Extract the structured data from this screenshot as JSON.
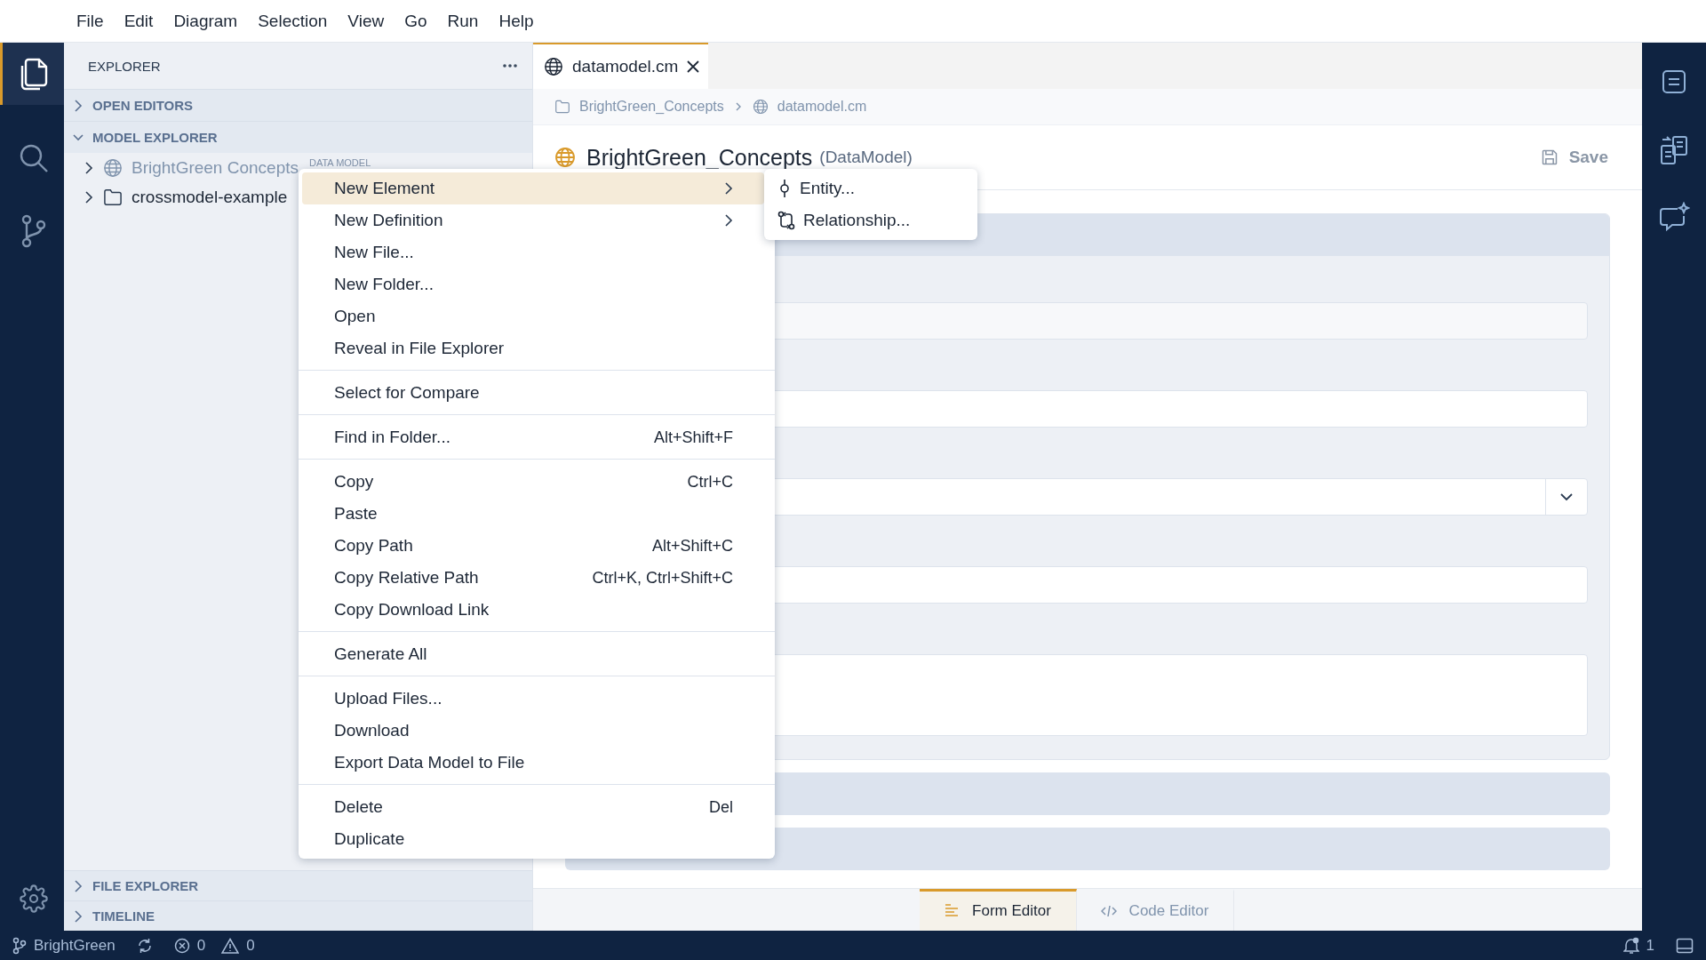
{
  "menubar": [
    "File",
    "Edit",
    "Diagram",
    "Selection",
    "View",
    "Go",
    "Run",
    "Help"
  ],
  "activity_bar": {
    "items": [
      {
        "kind": "files",
        "selected": true
      },
      {
        "kind": "search",
        "selected": false
      },
      {
        "kind": "source-control",
        "selected": false
      }
    ],
    "bottom": [
      {
        "kind": "settings"
      }
    ]
  },
  "sidebar": {
    "title": "EXPLORER",
    "sections": [
      {
        "label": "OPEN EDITORS",
        "expanded": false
      },
      {
        "label": "MODEL EXPLORER",
        "expanded": true,
        "items": [
          {
            "label": "BrightGreen Concepts",
            "badge": "DATA MODEL",
            "kind": "model",
            "expanded": false
          },
          {
            "label": "crossmodel-example",
            "kind": "folder",
            "expanded": false
          }
        ]
      }
    ],
    "bottom_sections": [
      {
        "label": "FILE EXPLORER",
        "expanded": false
      },
      {
        "label": "TIMELINE",
        "expanded": false
      }
    ]
  },
  "editor": {
    "tabs": [
      {
        "label": "datamodel.cm",
        "selected": true
      }
    ],
    "breadcrumb": [
      {
        "label": "BrightGreen_Concepts",
        "kind": "folder"
      },
      {
        "label": "datamodel.cm",
        "kind": "model"
      }
    ],
    "title": "BrightGreen_Concepts",
    "type": "(DataModel)",
    "save": {
      "label": "Save",
      "disabled": true
    },
    "form": {
      "fields": [
        {
          "kind": "input"
        },
        {
          "kind": "input"
        },
        {
          "kind": "select"
        },
        {
          "kind": "input"
        },
        {
          "kind": "textarea"
        }
      ]
    },
    "view_tabs": [
      {
        "label": "Form Editor",
        "kind": "form",
        "selected": true
      },
      {
        "label": "Code Editor",
        "kind": "code",
        "selected": false
      }
    ]
  },
  "right_bar": [
    {
      "kind": "outline"
    },
    {
      "kind": "properties"
    },
    {
      "kind": "chat"
    }
  ],
  "context_menu": {
    "groups": [
      {
        "items": [
          {
            "label": "New Element",
            "submenu": true,
            "selected": true
          },
          {
            "label": "New Definition",
            "submenu": true,
            "selected": false
          },
          {
            "label": "New File...",
            "selected": false
          },
          {
            "label": "New Folder...",
            "selected": false
          },
          {
            "label": "Open",
            "selected": false
          },
          {
            "label": "Reveal in File Explorer",
            "selected": false
          }
        ]
      },
      {
        "items": [
          {
            "label": "Select for Compare",
            "selected": false
          }
        ]
      },
      {
        "items": [
          {
            "label": "Find in Folder...",
            "shortcut": "Alt+Shift+F",
            "selected": false
          }
        ]
      },
      {
        "items": [
          {
            "label": "Copy",
            "shortcut": "Ctrl+C",
            "selected": false
          },
          {
            "label": "Paste",
            "selected": false
          },
          {
            "label": "Copy Path",
            "shortcut": "Alt+Shift+C",
            "selected": false
          },
          {
            "label": "Copy Relative Path",
            "shortcut": "Ctrl+K, Ctrl+Shift+C",
            "selected": false
          },
          {
            "label": "Copy Download Link",
            "selected": false
          }
        ]
      },
      {
        "items": [
          {
            "label": "Generate All",
            "selected": false
          }
        ]
      },
      {
        "items": [
          {
            "label": "Upload Files...",
            "selected": false
          },
          {
            "label": "Download",
            "selected": false
          },
          {
            "label": "Export Data Model to File",
            "selected": false
          }
        ]
      },
      {
        "items": [
          {
            "label": "Delete",
            "shortcut": "Del",
            "selected": false
          },
          {
            "label": "Duplicate",
            "selected": false
          }
        ]
      }
    ]
  },
  "submenu": {
    "items": [
      {
        "label": "Entity...",
        "kind": "entity"
      },
      {
        "label": "Relationship...",
        "kind": "relationship"
      }
    ]
  },
  "status_bar": {
    "branch": "BrightGreen",
    "errors": "0",
    "warnings": "0",
    "notifications": "1"
  }
}
